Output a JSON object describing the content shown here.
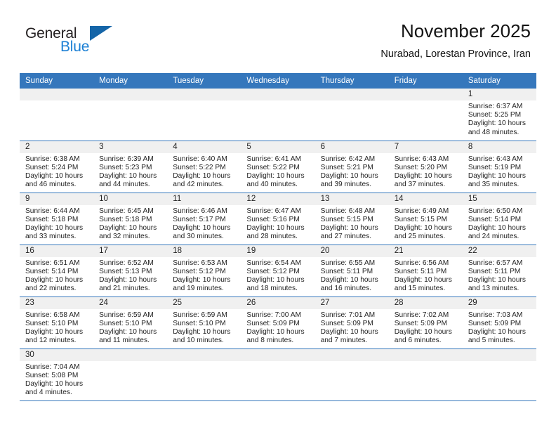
{
  "brand": {
    "name_top": "General",
    "name_bottom": "Blue",
    "accent_color": "#1b7fd4",
    "triangle_color": "#1565a8",
    "triangle_icon": "play-triangle-icon"
  },
  "header": {
    "title": "November 2025",
    "subtitle": "Nurabad, Lorestan Province, Iran"
  },
  "calendar": {
    "header_background": "#3577bc",
    "header_text_color": "#ffffff",
    "daynum_band_color": "#f0f0f0",
    "weekdays": [
      "Sunday",
      "Monday",
      "Tuesday",
      "Wednesday",
      "Thursday",
      "Friday",
      "Saturday"
    ],
    "weeks": [
      [
        {
          "day": "",
          "sunrise": "",
          "sunset": "",
          "daylight": ""
        },
        {
          "day": "",
          "sunrise": "",
          "sunset": "",
          "daylight": ""
        },
        {
          "day": "",
          "sunrise": "",
          "sunset": "",
          "daylight": ""
        },
        {
          "day": "",
          "sunrise": "",
          "sunset": "",
          "daylight": ""
        },
        {
          "day": "",
          "sunrise": "",
          "sunset": "",
          "daylight": ""
        },
        {
          "day": "",
          "sunrise": "",
          "sunset": "",
          "daylight": ""
        },
        {
          "day": "1",
          "sunrise": "Sunrise: 6:37 AM",
          "sunset": "Sunset: 5:25 PM",
          "daylight": "Daylight: 10 hours and 48 minutes."
        }
      ],
      [
        {
          "day": "2",
          "sunrise": "Sunrise: 6:38 AM",
          "sunset": "Sunset: 5:24 PM",
          "daylight": "Daylight: 10 hours and 46 minutes."
        },
        {
          "day": "3",
          "sunrise": "Sunrise: 6:39 AM",
          "sunset": "Sunset: 5:23 PM",
          "daylight": "Daylight: 10 hours and 44 minutes."
        },
        {
          "day": "4",
          "sunrise": "Sunrise: 6:40 AM",
          "sunset": "Sunset: 5:22 PM",
          "daylight": "Daylight: 10 hours and 42 minutes."
        },
        {
          "day": "5",
          "sunrise": "Sunrise: 6:41 AM",
          "sunset": "Sunset: 5:22 PM",
          "daylight": "Daylight: 10 hours and 40 minutes."
        },
        {
          "day": "6",
          "sunrise": "Sunrise: 6:42 AM",
          "sunset": "Sunset: 5:21 PM",
          "daylight": "Daylight: 10 hours and 39 minutes."
        },
        {
          "day": "7",
          "sunrise": "Sunrise: 6:43 AM",
          "sunset": "Sunset: 5:20 PM",
          "daylight": "Daylight: 10 hours and 37 minutes."
        },
        {
          "day": "8",
          "sunrise": "Sunrise: 6:43 AM",
          "sunset": "Sunset: 5:19 PM",
          "daylight": "Daylight: 10 hours and 35 minutes."
        }
      ],
      [
        {
          "day": "9",
          "sunrise": "Sunrise: 6:44 AM",
          "sunset": "Sunset: 5:18 PM",
          "daylight": "Daylight: 10 hours and 33 minutes."
        },
        {
          "day": "10",
          "sunrise": "Sunrise: 6:45 AM",
          "sunset": "Sunset: 5:18 PM",
          "daylight": "Daylight: 10 hours and 32 minutes."
        },
        {
          "day": "11",
          "sunrise": "Sunrise: 6:46 AM",
          "sunset": "Sunset: 5:17 PM",
          "daylight": "Daylight: 10 hours and 30 minutes."
        },
        {
          "day": "12",
          "sunrise": "Sunrise: 6:47 AM",
          "sunset": "Sunset: 5:16 PM",
          "daylight": "Daylight: 10 hours and 28 minutes."
        },
        {
          "day": "13",
          "sunrise": "Sunrise: 6:48 AM",
          "sunset": "Sunset: 5:15 PM",
          "daylight": "Daylight: 10 hours and 27 minutes."
        },
        {
          "day": "14",
          "sunrise": "Sunrise: 6:49 AM",
          "sunset": "Sunset: 5:15 PM",
          "daylight": "Daylight: 10 hours and 25 minutes."
        },
        {
          "day": "15",
          "sunrise": "Sunrise: 6:50 AM",
          "sunset": "Sunset: 5:14 PM",
          "daylight": "Daylight: 10 hours and 24 minutes."
        }
      ],
      [
        {
          "day": "16",
          "sunrise": "Sunrise: 6:51 AM",
          "sunset": "Sunset: 5:14 PM",
          "daylight": "Daylight: 10 hours and 22 minutes."
        },
        {
          "day": "17",
          "sunrise": "Sunrise: 6:52 AM",
          "sunset": "Sunset: 5:13 PM",
          "daylight": "Daylight: 10 hours and 21 minutes."
        },
        {
          "day": "18",
          "sunrise": "Sunrise: 6:53 AM",
          "sunset": "Sunset: 5:12 PM",
          "daylight": "Daylight: 10 hours and 19 minutes."
        },
        {
          "day": "19",
          "sunrise": "Sunrise: 6:54 AM",
          "sunset": "Sunset: 5:12 PM",
          "daylight": "Daylight: 10 hours and 18 minutes."
        },
        {
          "day": "20",
          "sunrise": "Sunrise: 6:55 AM",
          "sunset": "Sunset: 5:11 PM",
          "daylight": "Daylight: 10 hours and 16 minutes."
        },
        {
          "day": "21",
          "sunrise": "Sunrise: 6:56 AM",
          "sunset": "Sunset: 5:11 PM",
          "daylight": "Daylight: 10 hours and 15 minutes."
        },
        {
          "day": "22",
          "sunrise": "Sunrise: 6:57 AM",
          "sunset": "Sunset: 5:11 PM",
          "daylight": "Daylight: 10 hours and 13 minutes."
        }
      ],
      [
        {
          "day": "23",
          "sunrise": "Sunrise: 6:58 AM",
          "sunset": "Sunset: 5:10 PM",
          "daylight": "Daylight: 10 hours and 12 minutes."
        },
        {
          "day": "24",
          "sunrise": "Sunrise: 6:59 AM",
          "sunset": "Sunset: 5:10 PM",
          "daylight": "Daylight: 10 hours and 11 minutes."
        },
        {
          "day": "25",
          "sunrise": "Sunrise: 6:59 AM",
          "sunset": "Sunset: 5:10 PM",
          "daylight": "Daylight: 10 hours and 10 minutes."
        },
        {
          "day": "26",
          "sunrise": "Sunrise: 7:00 AM",
          "sunset": "Sunset: 5:09 PM",
          "daylight": "Daylight: 10 hours and 8 minutes."
        },
        {
          "day": "27",
          "sunrise": "Sunrise: 7:01 AM",
          "sunset": "Sunset: 5:09 PM",
          "daylight": "Daylight: 10 hours and 7 minutes."
        },
        {
          "day": "28",
          "sunrise": "Sunrise: 7:02 AM",
          "sunset": "Sunset: 5:09 PM",
          "daylight": "Daylight: 10 hours and 6 minutes."
        },
        {
          "day": "29",
          "sunrise": "Sunrise: 7:03 AM",
          "sunset": "Sunset: 5:09 PM",
          "daylight": "Daylight: 10 hours and 5 minutes."
        }
      ],
      [
        {
          "day": "30",
          "sunrise": "Sunrise: 7:04 AM",
          "sunset": "Sunset: 5:08 PM",
          "daylight": "Daylight: 10 hours and 4 minutes."
        },
        {
          "day": "",
          "sunrise": "",
          "sunset": "",
          "daylight": ""
        },
        {
          "day": "",
          "sunrise": "",
          "sunset": "",
          "daylight": ""
        },
        {
          "day": "",
          "sunrise": "",
          "sunset": "",
          "daylight": ""
        },
        {
          "day": "",
          "sunrise": "",
          "sunset": "",
          "daylight": ""
        },
        {
          "day": "",
          "sunrise": "",
          "sunset": "",
          "daylight": ""
        },
        {
          "day": "",
          "sunrise": "",
          "sunset": "",
          "daylight": ""
        }
      ]
    ]
  }
}
